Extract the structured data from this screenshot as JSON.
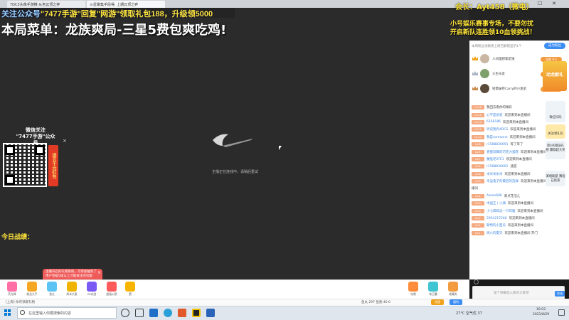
{
  "browser": {
    "tab1": "7DC3头像手游推 从务云顶之弈",
    "tab2": "三星聚集手段得, 上期云顶之弈"
  },
  "video": {
    "notice_prefix": "关注公众号",
    "notice_highlight": "\"7477手游\"回复\"网游\"领取礼包188，升级领5000",
    "headline": "本局菜单：龙族爽局-三星5费包爽吃鸡!",
    "loading_text": "主播正在连线中，请稍后重试",
    "wechat_title_line1": "微信关注",
    "wechat_title_line2": "\"7477手游\"公众号",
    "redbag_label": "送五千元红包",
    "close_symbol": "×",
    "today_record": "今日战绩：",
    "promo_bubble": "主播开启的礼物系统，可参加抽奖了 用户等级5级以上才能关注的功能"
  },
  "right_panel": {
    "fan_name": "会长：Ayt458（微电）",
    "promo_line1": "小号娱乐赛事专场，不要勿扰",
    "promo_line2": "开启新队连胜领10血领挑战！",
    "rank_header": "本周粉丝贡献榜上榜已解锁显示1个",
    "fan_button": "成为粉丝",
    "rank": [
      {
        "name": "人间理想家是谁",
        "badge": "贡献 9.4"
      },
      {
        "name": "三生乐友",
        "badge": "贡献 1.8"
      },
      {
        "name": "轻擎破苍Carry的小迷弟",
        "badge": "贡献 1"
      }
    ],
    "gift_box_label": "动龙献礼",
    "chat": [
      {
        "lvl": "LV.18",
        "user": "",
        "msg": "我回去看你的精彩"
      },
      {
        "lvl": "LV.16",
        "user": "心不是伪装",
        "msg": "欢迎来到本直播间"
      },
      {
        "lvl": "LV.14",
        "user": "6168186",
        "msg": "欢迎来到本直播间"
      },
      {
        "lvl": "LV.12",
        "user": "听说我有4DCS",
        "msg": "欢迎来到本直播间"
      },
      {
        "lvl": "LV.10",
        "user": "我是someone",
        "msg": "欢迎来到本直播间"
      },
      {
        "lvl": "LV.8",
        "user": "r1588836691",
        "msg": "等了等了"
      },
      {
        "lvl": "LV.9",
        "user": "香蜜双蝶的巧克力蛋糕",
        "msg": "欢迎来到本直播间"
      },
      {
        "lvl": "LV.7",
        "user": "魔怪老2FE1",
        "msg": "欢迎来到本直播间"
      },
      {
        "lvl": "LV.6",
        "user": "r1588836691",
        "msg": "速度"
      },
      {
        "lvl": "LV.6",
        "user": "米米米米米",
        "msg": "欢迎来到本直播间"
      },
      {
        "lvl": "LV.5",
        "user": "幸运电子的最后的选择",
        "msg": "欢迎来到本直播间"
      },
      {
        "lvl": "",
        "user": "",
        "msg": "播间"
      },
      {
        "lvl": "LV.4",
        "user": "Aaron686",
        "msg": "来点花活儿"
      },
      {
        "lvl": "LV.3",
        "user": "中国王丨小满",
        "msg": "欢迎来到本直播间"
      },
      {
        "lvl": "LV.3",
        "user": "小七碎碎念一只鸡腿",
        "msg": "欢迎来到本直播间"
      },
      {
        "lvl": "LV.2",
        "user": "5954217266",
        "msg": "欢迎来到本直播间"
      },
      {
        "lvl": "LV.2",
        "user": "斯特的小西瓜",
        "msg": "欢迎来到本直播间"
      },
      {
        "lvl": "LV.1",
        "user": "周六的夏天",
        "msg": "欢迎来到本直播间 开门"
      }
    ],
    "side_widget1": "微信扫码",
    "side_widget2": "关注领礼包",
    "side_widget3": "第4名赠送礼物 赢取超大奖",
    "side_widget4": "演唱联盟 赛程已结束",
    "input_placeholder": "发个弹幕加入聊天大家吧",
    "send_label": "发送"
  },
  "gifts": [
    {
      "name": "荧光棒",
      "color": "#ff6fa6"
    },
    {
      "name": "粉丝大手",
      "color": "#f5a623"
    },
    {
      "name": "鱼丸",
      "color": "#5cc3f5"
    },
    {
      "name": "周末大惠",
      "color": "#f0b400"
    },
    {
      "name": "PK对战",
      "color": "#7a5af5"
    },
    {
      "name": "超级火箭",
      "color": "#ff5a5a"
    },
    {
      "name": "赞",
      "color": "#f7b500"
    },
    {
      "name": "哇哦",
      "color": "#ff8c3a"
    },
    {
      "name": "帝王蟹",
      "color": "#3ec5d1"
    },
    {
      "name": "收藏夹",
      "color": "#f39b3f"
    },
    {
      "name": "任务",
      "color": "#b06cf0"
    },
    {
      "name": "礼物",
      "color": "#ff6fa6"
    }
  ],
  "status": {
    "left": "[上周] 你可领取礼物",
    "right": "鱼丸 297    鱼翅 40.0",
    "recharge": "充值",
    "vip": "福利"
  },
  "taskbar": {
    "search_text": "在这里输入你要搜索的内容",
    "weather": "27°C 空气优 37",
    "time": "16:03",
    "date": "2021/8/29"
  }
}
